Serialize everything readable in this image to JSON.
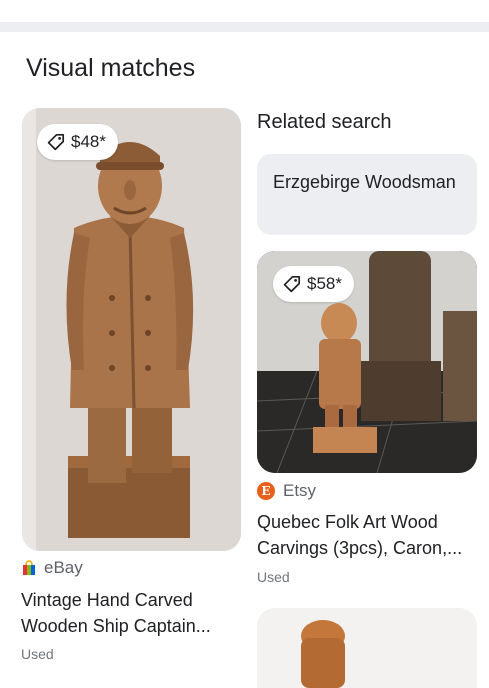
{
  "section": {
    "title": "Visual matches"
  },
  "related": {
    "title": "Related search",
    "chip_label": "Erzgebirge Woodsman"
  },
  "results": [
    {
      "price": "$48*",
      "source": "eBay",
      "title_line1": "Vintage Hand Carved",
      "title_line2": "Wooden Ship Captain...",
      "condition": "Used",
      "image_icon": "wood-carving-captain-image"
    },
    {
      "price": "$58*",
      "source": "Etsy",
      "title_line1": "Quebec Folk Art Wood",
      "title_line2": "Carvings (3pcs), Caron,...",
      "condition": "Used",
      "image_icon": "wood-carvings-group-image"
    },
    {
      "image_icon": "wood-carving-head-image"
    }
  ],
  "icons": {
    "price": "tag-icon",
    "ebay": "ebay-bag-icon",
    "etsy": "etsy-logo-icon"
  },
  "colors": {
    "chip_background": "#eceef1",
    "etsy_orange": "#e8601c",
    "secondary_text": "#5f6368"
  }
}
